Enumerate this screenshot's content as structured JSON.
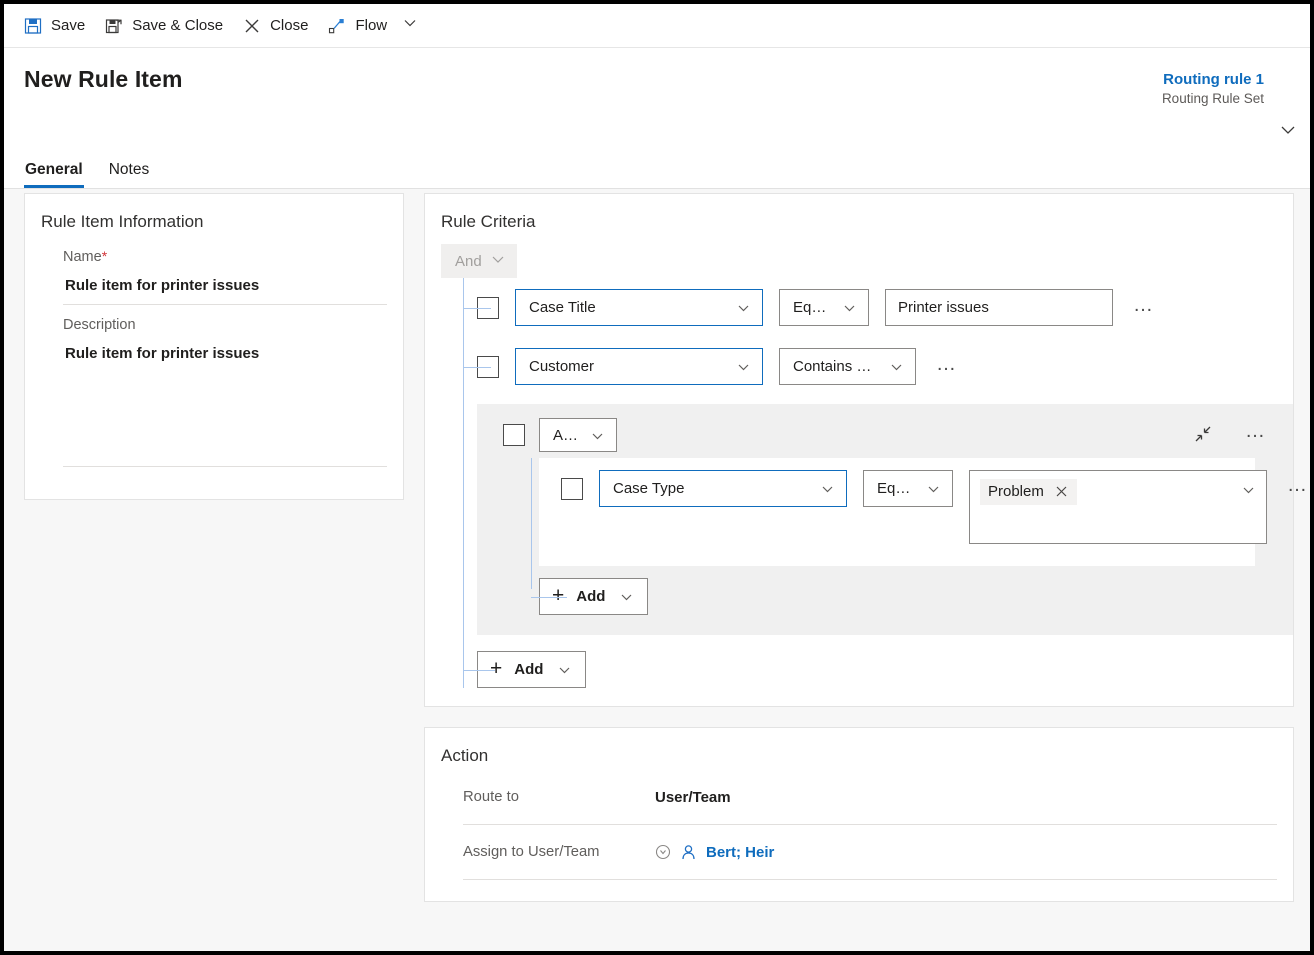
{
  "commandbar": {
    "buttons": [
      {
        "label": "Save",
        "icon": "save-icon"
      },
      {
        "label": "Save & Close",
        "icon": "save-and-close-icon"
      },
      {
        "label": "Close",
        "icon": "close-x-icon"
      },
      {
        "label": "Flow",
        "icon": "flow-icon"
      }
    ],
    "overflow_caret": "chevron-down-icon"
  },
  "header": {
    "title": "New Rule Item",
    "tabs": [
      {
        "label": "General",
        "active": true
      },
      {
        "label": "Notes",
        "active": false
      }
    ],
    "context": {
      "name": "Routing rule 1",
      "subtitle": "Routing Rule Set"
    },
    "chevron": "chevron-down-icon"
  },
  "rule_item_information": {
    "title": "Rule Item Information",
    "name_label": "Name",
    "name_required_marker": "*",
    "name_value": "Rule item for printer issues",
    "description_label": "Description",
    "description_value": "Rule item for printer issues"
  },
  "rule_criteria": {
    "title": "Rule Criteria",
    "root_operator": "And",
    "rows": [
      {
        "field": "Case Title",
        "operator": "Equals",
        "value": "Printer issues",
        "more": "…"
      },
      {
        "field": "Customer",
        "operator": "Contains data",
        "more": "…"
      }
    ],
    "nested_group": {
      "operator": "And",
      "collapse_icon": "collapse-icon",
      "more": "…",
      "row": {
        "field": "Case Type",
        "operator": "Equals",
        "tag": "Problem",
        "tag_remove": "×",
        "more": "…"
      },
      "add_label": "Add"
    },
    "add_label": "Add"
  },
  "action": {
    "title": "Action",
    "route_to_label": "Route to",
    "route_to_value": "User/Team",
    "assign_label": "Assign to User/Team",
    "assign_value": "Bert; Heir",
    "assign_lookup_icon": "lookup-circle-icon",
    "assign_person_icon": "person-icon"
  },
  "colors": {
    "accent_blue": "#0f6cbd",
    "link_blue": "#0f6cbd",
    "tree_line": "#a9c6ec",
    "group_bg": "#f0f0f0",
    "page_bg": "#f7f7f7",
    "required_red": "#d13438"
  }
}
